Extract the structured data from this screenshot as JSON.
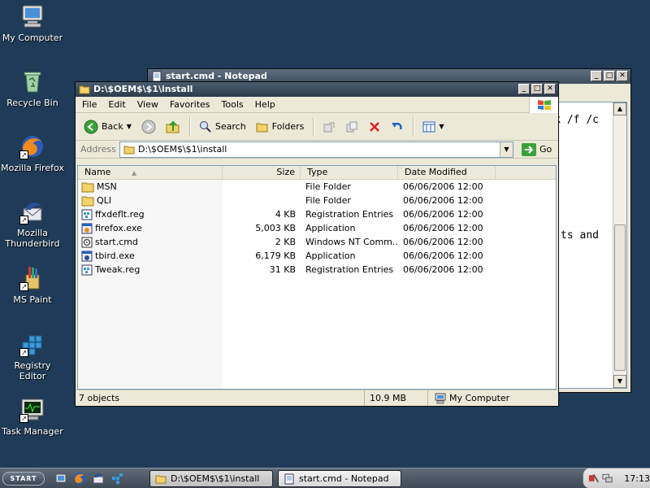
{
  "desktop": {
    "icons": [
      {
        "label": "My Computer",
        "icon": "my-computer-icon"
      },
      {
        "label": "Recycle Bin",
        "icon": "recycle-bin-icon"
      },
      {
        "label": "Mozilla Firefox",
        "icon": "firefox-icon"
      },
      {
        "label": "Mozilla Thunderbird",
        "icon": "thunderbird-icon"
      },
      {
        "label": "MS Paint",
        "icon": "paint-icon"
      },
      {
        "label": "Registry Editor",
        "icon": "registry-editor-icon"
      },
      {
        "label": "Task Manager",
        "icon": "task-manager-icon"
      }
    ]
  },
  "notepad": {
    "title": "start.cmd - Notepad",
    "text_line1": "k /f /c",
    "text_line2": "ts and"
  },
  "explorer": {
    "title": "D:\\$OEM$\\$1\\install",
    "menu": [
      "File",
      "Edit",
      "View",
      "Favorites",
      "Tools",
      "Help"
    ],
    "toolbar": {
      "back": "Back",
      "search": "Search",
      "folders": "Folders"
    },
    "address": {
      "label": "Address",
      "value": "D:\\$OEM$\\$1\\install",
      "go": "Go"
    },
    "columns": {
      "name": "Name",
      "size": "Size",
      "type": "Type",
      "date": "Date Modified"
    },
    "files": [
      {
        "name": "MSN",
        "size": "",
        "type": "File Folder",
        "date": "06/06/2006 12:00",
        "icon": "folder-icon"
      },
      {
        "name": "QLI",
        "size": "",
        "type": "File Folder",
        "date": "06/06/2006 12:00",
        "icon": "folder-icon"
      },
      {
        "name": "ffxdeflt.reg",
        "size": "4 KB",
        "type": "Registration Entries",
        "date": "06/06/2006 12:00",
        "icon": "reg-file-icon"
      },
      {
        "name": "firefox.exe",
        "size": "5,003 KB",
        "type": "Application",
        "date": "06/06/2006 12:00",
        "icon": "exe-file-icon"
      },
      {
        "name": "start.cmd",
        "size": "2 KB",
        "type": "Windows NT Comm...",
        "date": "06/06/2006 12:00",
        "icon": "cmd-file-icon"
      },
      {
        "name": "tbird.exe",
        "size": "6,179 KB",
        "type": "Application",
        "date": "06/06/2006 12:00",
        "icon": "exe-file-icon"
      },
      {
        "name": "Tweak.reg",
        "size": "31 KB",
        "type": "Registration Entries",
        "date": "06/06/2006 12:00",
        "icon": "reg-file-icon"
      }
    ],
    "status": {
      "objects": "7 objects",
      "size": "10.9 MB",
      "location": "My Computer"
    }
  },
  "taskbar": {
    "start": "START",
    "tasks": [
      {
        "label": "D:\\$OEM$\\$1\\install"
      },
      {
        "label": "start.cmd - Notepad"
      }
    ],
    "clock": "17:13"
  }
}
